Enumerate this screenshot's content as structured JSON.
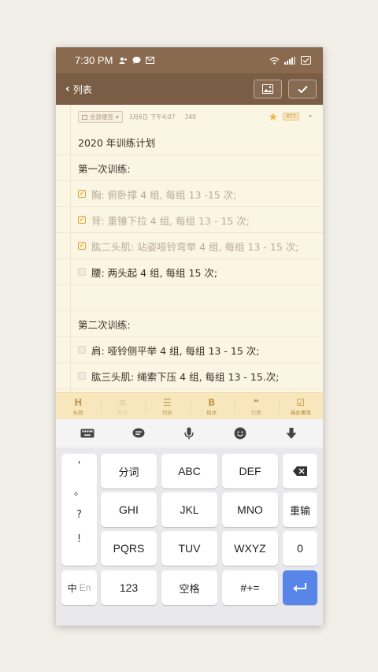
{
  "status": {
    "time": "7:30 PM"
  },
  "topbar": {
    "back_label": "列表"
  },
  "note": {
    "tag_label": "全部便签",
    "date": "3月6日 下午4:07",
    "char_count": "340",
    "format_badge": "RTF",
    "lines": [
      {
        "text": "2020 年训练计划",
        "type": "text"
      },
      {
        "text": "第一次训练:",
        "type": "text"
      },
      {
        "text": "胸: 俯卧撑 4 组, 每组 13 -15 次;",
        "type": "todo",
        "checked": true
      },
      {
        "text": "背: 重锤下拉 4 组, 每组 13 - 15 次;",
        "type": "todo",
        "checked": true
      },
      {
        "text": "肱二头肌: 站姿哑铃弯举 4 组, 每组 13 - 15 次;",
        "type": "todo",
        "checked": true
      },
      {
        "text": "腰: 两头起 4 组, 每组 15 次;",
        "type": "todo",
        "checked": false
      },
      {
        "text": "",
        "type": "text"
      },
      {
        "text": "第二次训练:",
        "type": "text"
      },
      {
        "text": "肩: 哑铃侧平举 4 组, 每组 13 - 15 次;",
        "type": "todo",
        "checked": false
      },
      {
        "text": "肱三头肌: 绳索下压 4 组, 每组 13 - 15.次;",
        "type": "todo",
        "checked": false
      }
    ]
  },
  "format_bar": {
    "items": [
      {
        "glyph": "H",
        "label": "标题"
      },
      {
        "glyph": "≡",
        "label": "有序"
      },
      {
        "glyph": "☰",
        "label": "列表"
      },
      {
        "glyph": "B",
        "label": "粗体"
      },
      {
        "glyph": "❝",
        "label": "引用"
      },
      {
        "glyph": "☑",
        "label": "待办事项"
      }
    ]
  },
  "keyboard": {
    "punctuation": [
      "'",
      "。",
      "?",
      "!"
    ],
    "row1": [
      "分词",
      "ABC",
      "DEF"
    ],
    "row2": [
      "GHI",
      "JKL",
      "MNO",
      "重输"
    ],
    "row3": [
      "PQRS",
      "TUV",
      "WXYZ",
      "0"
    ],
    "row4": {
      "lang_cn": "中",
      "lang_en": "En",
      "num": "123",
      "space": "空格",
      "sym": "#+="
    }
  },
  "colors": {
    "status_bar": "#8a6a4e",
    "top_bar": "#7b5d45",
    "paper": "#fbf5e4",
    "accent_yellow": "#f0b84a",
    "enter_key": "#5786e8"
  }
}
